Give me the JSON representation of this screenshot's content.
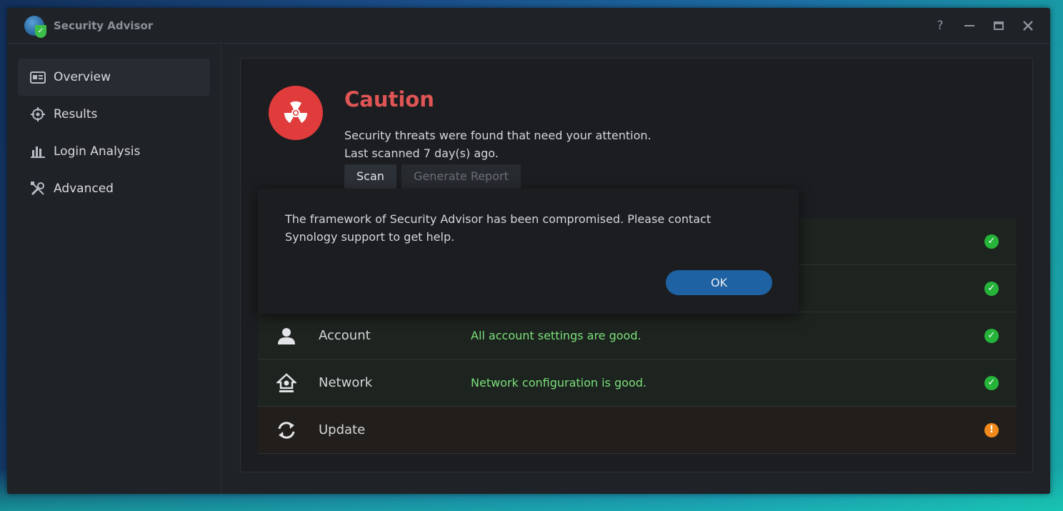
{
  "app": {
    "title": "Security Advisor",
    "logo_icon": "globe-shield-icon"
  },
  "window_controls": {
    "help": "?",
    "icons": [
      "help-icon",
      "minimize-icon",
      "maximize-icon",
      "close-icon"
    ]
  },
  "sidebar": {
    "items": [
      {
        "label": "Overview",
        "icon": "overview-card-icon",
        "active": true
      },
      {
        "label": "Results",
        "icon": "target-icon",
        "active": false
      },
      {
        "label": "Login Analysis",
        "icon": "bar-chart-icon",
        "active": false
      },
      {
        "label": "Advanced",
        "icon": "tools-icon",
        "active": false
      }
    ]
  },
  "summary": {
    "status_title": "Caution",
    "icon": "radiation-icon",
    "message": "Security threats were found that need your attention.",
    "last_scanned": "Last scanned 7 day(s) ago.",
    "scan_button": "Scan",
    "report_button": "Generate Report"
  },
  "checks": [
    {
      "name": "",
      "status_text": "",
      "result": "ok"
    },
    {
      "name": "",
      "status_text": "",
      "result": "ok"
    },
    {
      "name": "Account",
      "icon": "user-icon",
      "status_text": "All account settings are good.",
      "result": "ok"
    },
    {
      "name": "Network",
      "icon": "network-home-icon",
      "status_text": "Network configuration is good.",
      "result": "ok"
    },
    {
      "name": "Update",
      "icon": "refresh-icon",
      "status_text": "",
      "result": "warning"
    }
  ],
  "dialog": {
    "message_line1": "The framework of Security Advisor has been compromised. Please contact",
    "message_line2": "Synology support to get help.",
    "ok_label": "OK"
  },
  "colors": {
    "caution_red": "#e05555",
    "ok_green": "#26b33a",
    "warn_orange": "#f08a1c",
    "status_text_green": "#7be07a",
    "ok_button_blue": "#1f62a3"
  }
}
